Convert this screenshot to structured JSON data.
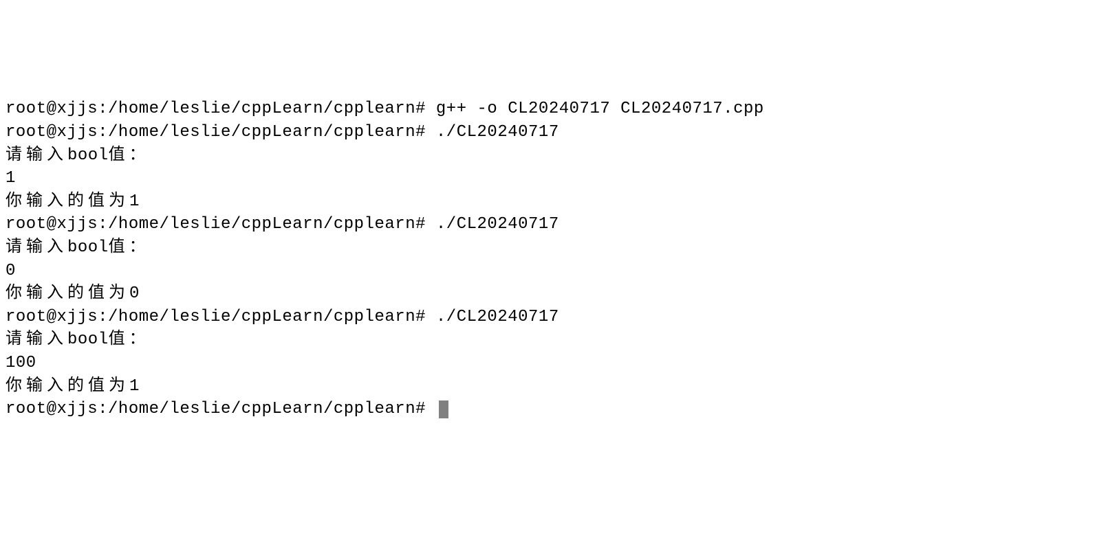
{
  "lines": [
    {
      "prompt": "root@xjjs:/home/leslie/cppLearn/cpplearn# ",
      "cmd": "g++ -o CL20240717 CL20240717.cpp"
    },
    {
      "prompt": "root@xjjs:/home/leslie/cppLearn/cpplearn# ",
      "cmd": "./CL20240717"
    },
    {
      "cjk": "请输入",
      "rest": "bool",
      "cjk2": "值："
    },
    {
      "text": "1"
    },
    {
      "cjk": "你输入的值为",
      "rest": "1"
    },
    {
      "prompt": "root@xjjs:/home/leslie/cppLearn/cpplearn# ",
      "cmd": "./CL20240717"
    },
    {
      "cjk": "请输入",
      "rest": "bool",
      "cjk2": "值："
    },
    {
      "text": "0"
    },
    {
      "cjk": "你输入的值为",
      "rest": "0"
    },
    {
      "prompt": "root@xjjs:/home/leslie/cppLearn/cpplearn# ",
      "cmd": "./CL20240717"
    },
    {
      "cjk": "请输入",
      "rest": "bool",
      "cjk2": "值："
    },
    {
      "text": "100"
    },
    {
      "cjk": "你输入的值为",
      "rest": "1"
    },
    {
      "prompt": "root@xjjs:/home/leslie/cppLearn/cpplearn# ",
      "cursor": true
    }
  ]
}
